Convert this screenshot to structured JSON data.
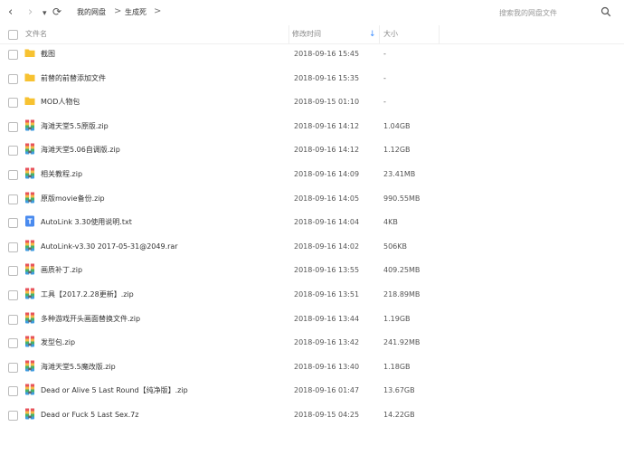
{
  "toolbar": {
    "back": "‹",
    "forward": "›",
    "dropdown": "▾",
    "refresh": "⟳",
    "breadcrumb": [
      "我的网盘",
      "生成死"
    ],
    "separator": ">",
    "search_placeholder": "搜索我的网盘文件"
  },
  "columns": {
    "name": "文件名",
    "date": "修改时间",
    "sort_arrow": "↓",
    "size": "大小"
  },
  "files": [
    {
      "name": "截图",
      "date": "2018-09-16 15:45",
      "size": "-",
      "icon": "folder-icon"
    },
    {
      "name": "前替的前替添加文件",
      "date": "2018-09-16 15:35",
      "size": "-",
      "icon": "folder-icon"
    },
    {
      "name": "MOD人物包",
      "date": "2018-09-15 01:10",
      "size": "-",
      "icon": "folder-icon"
    },
    {
      "name": "海滩天堂5.5原版.zip",
      "date": "2018-09-16 14:12",
      "size": "1.04GB",
      "icon": "archive-icon"
    },
    {
      "name": "海滩天堂5.06自调版.zip",
      "date": "2018-09-16 14:12",
      "size": "1.12GB",
      "icon": "archive-icon"
    },
    {
      "name": "相关教程.zip",
      "date": "2018-09-16 14:09",
      "size": "23.41MB",
      "icon": "archive-icon"
    },
    {
      "name": "原版movie备份.zip",
      "date": "2018-09-16 14:05",
      "size": "990.55MB",
      "icon": "archive-icon"
    },
    {
      "name": "AutoLink 3.30使用说明.txt",
      "date": "2018-09-16 14:04",
      "size": "4KB",
      "icon": "text-file-icon"
    },
    {
      "name": "AutoLink-v3.30 2017-05-31@2049.rar",
      "date": "2018-09-16 14:02",
      "size": "506KB",
      "icon": "archive-icon"
    },
    {
      "name": "画质补丁.zip",
      "date": "2018-09-16 13:55",
      "size": "409.25MB",
      "icon": "archive-icon"
    },
    {
      "name": "工具【2017.2.28更新】.zip",
      "date": "2018-09-16 13:51",
      "size": "218.89MB",
      "icon": "archive-icon"
    },
    {
      "name": "多种游戏开头画面替换文件.zip",
      "date": "2018-09-16 13:44",
      "size": "1.19GB",
      "icon": "archive-icon"
    },
    {
      "name": "发型包.zip",
      "date": "2018-09-16 13:42",
      "size": "241.92MB",
      "icon": "archive-icon"
    },
    {
      "name": "海滩天堂5.5魔改版.zip",
      "date": "2018-09-16 13:40",
      "size": "1.18GB",
      "icon": "archive-icon"
    },
    {
      "name": "Dead or Alive 5 Last Round【纯净版】.zip",
      "date": "2018-09-16 01:47",
      "size": "13.67GB",
      "icon": "archive-icon"
    },
    {
      "name": "Dead or Fuck 5 Last Sex.7z",
      "date": "2018-09-15 04:25",
      "size": "14.22GB",
      "icon": "archive-icon"
    }
  ],
  "colors": {
    "folder": "#F7C231",
    "archive_a": "#E8545B",
    "archive_b": "#45B36B",
    "archive_c": "#F5B947",
    "archive_d": "#3E9BE0",
    "text_file": "#4A8BEF"
  }
}
